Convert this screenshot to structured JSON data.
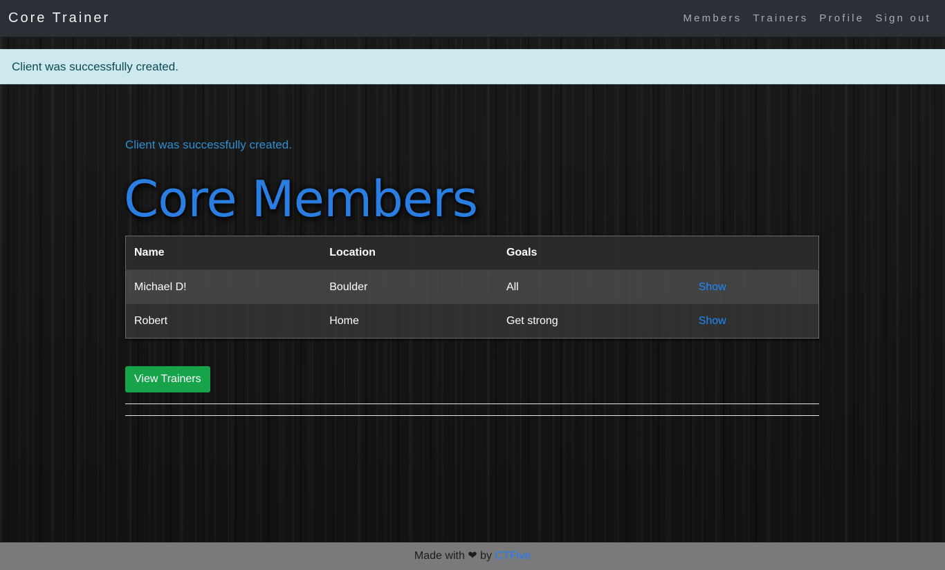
{
  "navbar": {
    "brand": "Core Trainer",
    "links": [
      {
        "label": "Members"
      },
      {
        "label": "Trainers"
      },
      {
        "label": "Profile"
      },
      {
        "label": "Sign out"
      }
    ]
  },
  "alert": {
    "message": "Client was successfully created."
  },
  "main": {
    "notice": "Client was successfully created.",
    "title": "Core Members",
    "table": {
      "headers": [
        "Name",
        "Location",
        "Goals",
        ""
      ],
      "rows": [
        {
          "name": "Michael D!",
          "location": "Boulder",
          "goals": "All",
          "action": "Show"
        },
        {
          "name": "Robert",
          "location": "Home",
          "goals": "Get strong",
          "action": "Show"
        }
      ]
    },
    "view_trainers_label": "View Trainers"
  },
  "footer": {
    "made_with": "Made with",
    "heart": "❤",
    "by": "by",
    "author": "CTFive"
  },
  "colors": {
    "accent": "#2a7de1",
    "link": "#1e88ff",
    "success": "#16a34a",
    "alert_bg": "#cde9ee"
  }
}
